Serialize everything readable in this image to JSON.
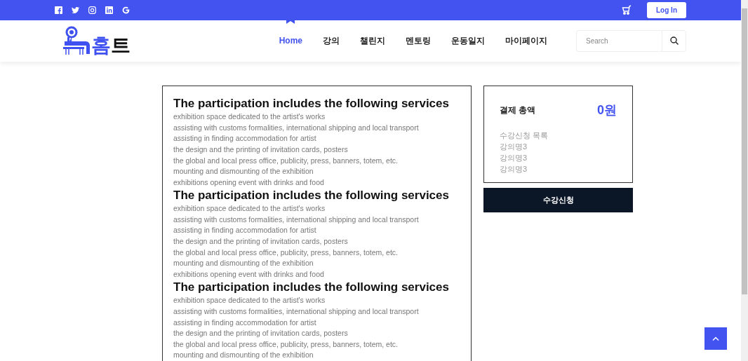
{
  "topbar": {
    "social": [
      {
        "kind": "facebook"
      },
      {
        "kind": "twitter"
      },
      {
        "kind": "instagram"
      },
      {
        "kind": "linkedin"
      },
      {
        "kind": "google"
      }
    ],
    "login": "Log In"
  },
  "logo": {
    "text_1": "홈",
    "text_2": "트"
  },
  "nav": [
    {
      "label": "Home",
      "selected": true
    },
    {
      "label": "강의",
      "selected": false
    },
    {
      "label": "챌린지",
      "selected": false
    },
    {
      "label": "멘토링",
      "selected": false
    },
    {
      "label": "운동일지",
      "selected": false
    },
    {
      "label": "마이페이지",
      "selected": false
    }
  ],
  "search": {
    "placeholder": "Search"
  },
  "sections": [
    {
      "title": "The participation includes the following services",
      "items": [
        "exhibition space dedicated to the artist's works",
        "assisting with customs formalities, international shipping and local transport",
        "assisting in finding accommodation for artist",
        "the design and the printing of invitation cards, posters",
        "the global and local press office, publicity, press, banners, totem, etc.",
        "mounting and dismounting of the exhibition",
        "exhibitions opening event with drinks and food"
      ]
    },
    {
      "title": "The participation includes the following services",
      "items": [
        "exhibition space dedicated to the artist's works",
        "assisting with customs formalities, international shipping and local transport",
        "assisting in finding accommodation for artist",
        "the design and the printing of invitation cards, posters",
        "the global and local press office, publicity, press, banners, totem, etc.",
        "mounting and dismounting of the exhibition",
        "exhibitions opening event with drinks and food"
      ]
    },
    {
      "title": "The participation includes the following services",
      "items": [
        "exhibition space dedicated to the artist's works",
        "assisting with customs formalities, international shipping and local transport",
        "assisting in finding accommodation for artist",
        "the design and the printing of invitation cards, posters",
        "the global and local press office, publicity, press, banners, totem, etc.",
        "mounting and dismounting of the exhibition"
      ]
    }
  ],
  "summary": {
    "total_label": "결제 총액",
    "total": "0원",
    "list_title": "수강신청 목록",
    "courses": [
      "강의명3",
      "강의명3",
      "강의명3"
    ]
  },
  "enroll_button": "수강신청"
}
